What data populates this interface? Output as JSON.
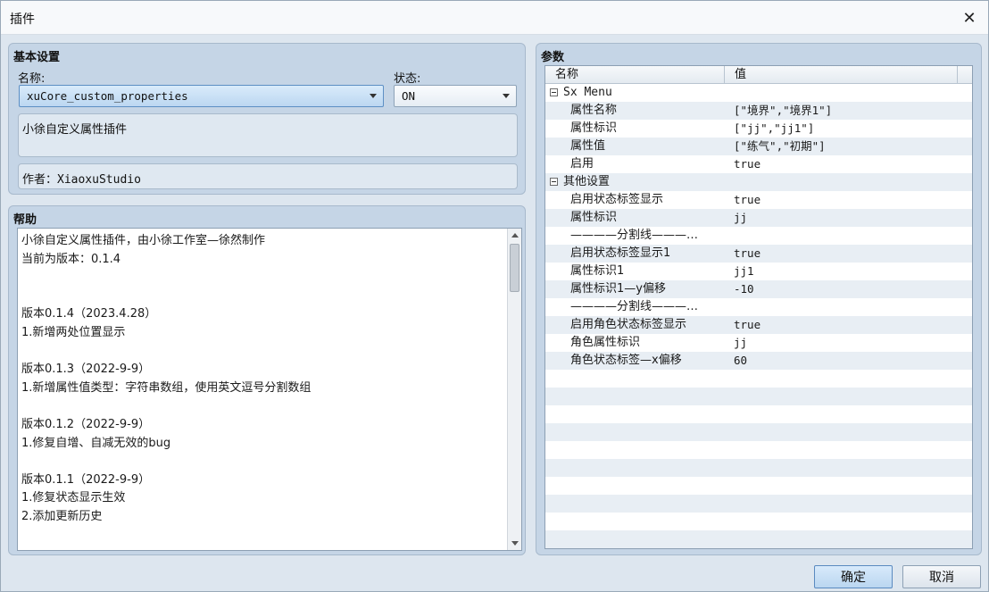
{
  "window": {
    "title": "插件"
  },
  "basic": {
    "title": "基本设置",
    "name_label": "名称:",
    "status_label": "状态:",
    "plugin_name": "xuCore_custom_properties",
    "status_value": "ON",
    "description": "小徐自定义属性插件",
    "author": "作者：XiaoxuStudio"
  },
  "help": {
    "title": "帮助",
    "lines": [
      "小徐自定义属性插件，由小徐工作室—徐然制作",
      "当前为版本：0.1.4",
      "",
      "",
      "版本0.1.4（2023.4.28）",
      "1.新增两处位置显示",
      "",
      "版本0.1.3（2022-9-9）",
      "1.新增属性值类型：字符串数组，使用英文逗号分割数组",
      "",
      "版本0.1.2（2022-9-9）",
      "1.修复自增、自减无效的bug",
      "",
      "版本0.1.1（2022-9-9）",
      "1.修复状态显示生效",
      "2.添加更新历史"
    ]
  },
  "params": {
    "title": "参数",
    "col_name": "名称",
    "col_value": "值",
    "rows": [
      {
        "type": "group",
        "name": "Sx Menu",
        "value": ""
      },
      {
        "type": "item",
        "name": "属性名称",
        "value": "[\"境界\",\"境界1\"]"
      },
      {
        "type": "item",
        "name": "属性标识",
        "value": "[\"jj\",\"jj1\"]"
      },
      {
        "type": "item",
        "name": "属性值",
        "value": "[\"练气\",\"初期\"]"
      },
      {
        "type": "item",
        "name": "启用",
        "value": "true"
      },
      {
        "type": "group",
        "name": "其他设置",
        "value": ""
      },
      {
        "type": "item",
        "name": "启用状态标签显示",
        "value": "true"
      },
      {
        "type": "item",
        "name": "属性标识",
        "value": "jj"
      },
      {
        "type": "item",
        "name": "————分割线———…",
        "value": ""
      },
      {
        "type": "item",
        "name": "启用状态标签显示1",
        "value": "true"
      },
      {
        "type": "item",
        "name": "属性标识1",
        "value": "jj1"
      },
      {
        "type": "item",
        "name": "属性标识1—y偏移",
        "value": "-10"
      },
      {
        "type": "item",
        "name": "————分割线———…",
        "value": ""
      },
      {
        "type": "item",
        "name": "启用角色状态标签显示",
        "value": "true"
      },
      {
        "type": "item",
        "name": "角色属性标识",
        "value": "jj"
      },
      {
        "type": "item",
        "name": "角色状态标签—x偏移",
        "value": "60"
      }
    ]
  },
  "buttons": {
    "ok": "确定",
    "cancel": "取消"
  }
}
